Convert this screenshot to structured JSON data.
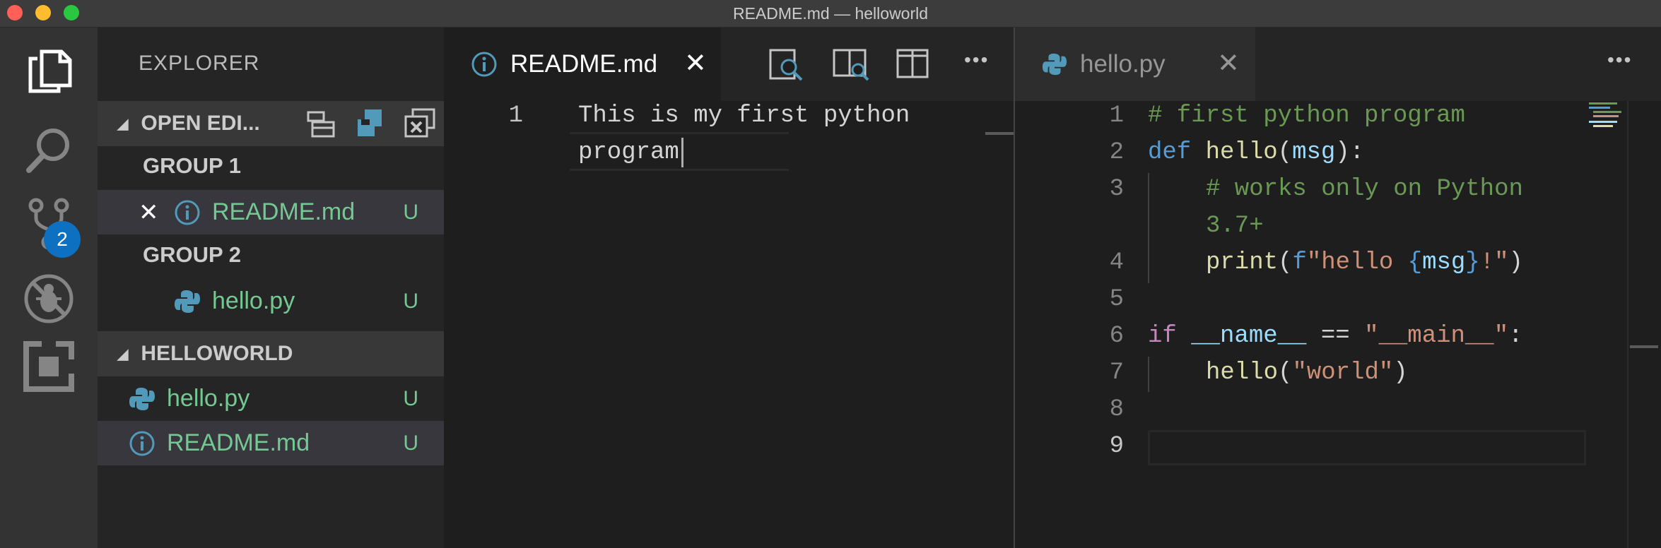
{
  "window": {
    "title": "README.md — helloworld"
  },
  "activity_bar": {
    "items": [
      {
        "name": "explorer",
        "icon": "files-icon"
      },
      {
        "name": "search",
        "icon": "search-icon"
      },
      {
        "name": "source-control",
        "icon": "source-control-icon",
        "badge": "2"
      },
      {
        "name": "debug",
        "icon": "debug-icon"
      },
      {
        "name": "extensions",
        "icon": "extensions-icon"
      }
    ]
  },
  "sidebar": {
    "title": "EXPLORER",
    "open_editors": {
      "header": "OPEN EDI...",
      "groups": [
        {
          "label": "GROUP 1",
          "files": [
            {
              "name": "README.md",
              "status": "U",
              "icon": "info-icon",
              "close": "✕"
            }
          ]
        },
        {
          "label": "GROUP 2",
          "files": [
            {
              "name": "hello.py",
              "status": "U",
              "icon": "python-icon"
            }
          ]
        }
      ]
    },
    "folder": {
      "header": "HELLOWORLD",
      "files": [
        {
          "name": "hello.py",
          "status": "U",
          "icon": "python-icon"
        },
        {
          "name": "README.md",
          "status": "U",
          "icon": "info-icon"
        }
      ]
    }
  },
  "editor_left": {
    "tab": {
      "label": "README.md",
      "close": "✕",
      "icon": "info-icon"
    },
    "toolbar": [
      "open-preview-icon",
      "open-preview-side-icon",
      "split-editor-icon",
      "more-icon"
    ],
    "more": "•••",
    "line_numbers": [
      "1"
    ],
    "lines": [
      "This is my first python",
      "program"
    ]
  },
  "editor_right": {
    "tab": {
      "label": "hello.py",
      "close": "✕",
      "icon": "python-icon"
    },
    "more": "•••",
    "line_numbers": [
      "1",
      "2",
      "3",
      "4",
      "5",
      "6",
      "7",
      "8",
      "9"
    ],
    "code": {
      "l1": "# first python program",
      "l2_def": "def",
      "l2_fn": "hello",
      "l2_p1": "(",
      "l2_arg": "msg",
      "l2_p2": "):",
      "l3a": "# works only on Python",
      "l3b": "3.7+",
      "l4_fn": "print",
      "l4_p1": "(",
      "l4_f": "f",
      "l4_s1": "\"hello ",
      "l4_b1": "{",
      "l4_var": "msg",
      "l4_b2": "}",
      "l4_s2": "!\"",
      "l4_p2": ")",
      "l6_if": "if",
      "l6_name": "__name__",
      "l6_eq": "==",
      "l6_str": "\"__main__\"",
      "l6_colon": ":",
      "l7_fn": "hello",
      "l7_p1": "(",
      "l7_str": "\"world\"",
      "l7_p2": ")"
    }
  },
  "colors": {
    "accent": "#0e70c0",
    "untracked": "#73c991",
    "python_icon": "#519aba",
    "info_icon": "#519aba"
  }
}
